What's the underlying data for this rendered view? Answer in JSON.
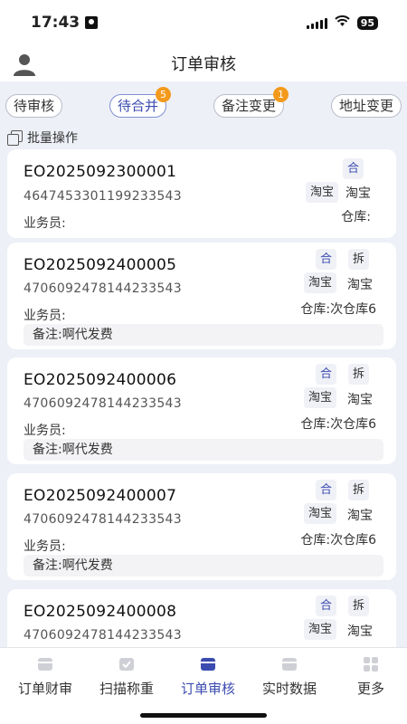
{
  "status_bar": {
    "time": "17:43",
    "battery": "95"
  },
  "header": {
    "title": "订单审核"
  },
  "filters": [
    {
      "label": "待审核",
      "badge": ""
    },
    {
      "label": "待合并",
      "badge": "5"
    },
    {
      "label": "备注变更",
      "badge": "1"
    },
    {
      "label": "地址变更",
      "badge": ""
    }
  ],
  "batch": {
    "label": "批量操作"
  },
  "orders": [
    {
      "order_no": "EO2025092300001",
      "code": "4647453301199233543",
      "clerk": "业务员:",
      "warehouse": "仓库:",
      "remark": "",
      "merge": "合",
      "split": "",
      "shop_a": "淘宝",
      "shop_b": "淘宝"
    },
    {
      "order_no": "EO2025092400005",
      "code": "4706092478144233543",
      "clerk": "业务员:",
      "warehouse": "仓库:次仓库6",
      "remark": "备注:啊代发费",
      "merge": "合",
      "split": "拆",
      "shop_a": "淘宝",
      "shop_b": "淘宝"
    },
    {
      "order_no": "EO2025092400006",
      "code": "4706092478144233543",
      "clerk": "业务员:",
      "warehouse": "仓库:次仓库6",
      "remark": "备注:啊代发费",
      "merge": "合",
      "split": "拆",
      "shop_a": "淘宝",
      "shop_b": "淘宝"
    },
    {
      "order_no": "EO2025092400007",
      "code": "4706092478144233543",
      "clerk": "业务员:",
      "warehouse": "仓库:次仓库6",
      "remark": "备注:啊代发费",
      "merge": "合",
      "split": "拆",
      "shop_a": "淘宝",
      "shop_b": "淘宝"
    },
    {
      "order_no": "EO2025092400008",
      "code": "4706092478144233543",
      "clerk": "",
      "warehouse": "",
      "remark": "",
      "merge": "合",
      "split": "拆",
      "shop_a": "淘宝",
      "shop_b": "淘宝"
    }
  ],
  "tabbar": [
    {
      "label": "订单财审",
      "icon": "box-icon"
    },
    {
      "label": "扫描称重",
      "icon": "scale-box-icon"
    },
    {
      "label": "订单审核",
      "icon": "box-icon",
      "active": true
    },
    {
      "label": "实时数据",
      "icon": "box-icon"
    },
    {
      "label": "更多",
      "icon": "grid-icon"
    }
  ],
  "colors": {
    "accent": "#3b4bb0",
    "badge": "#f39a1c",
    "background": "#eef0f7"
  }
}
